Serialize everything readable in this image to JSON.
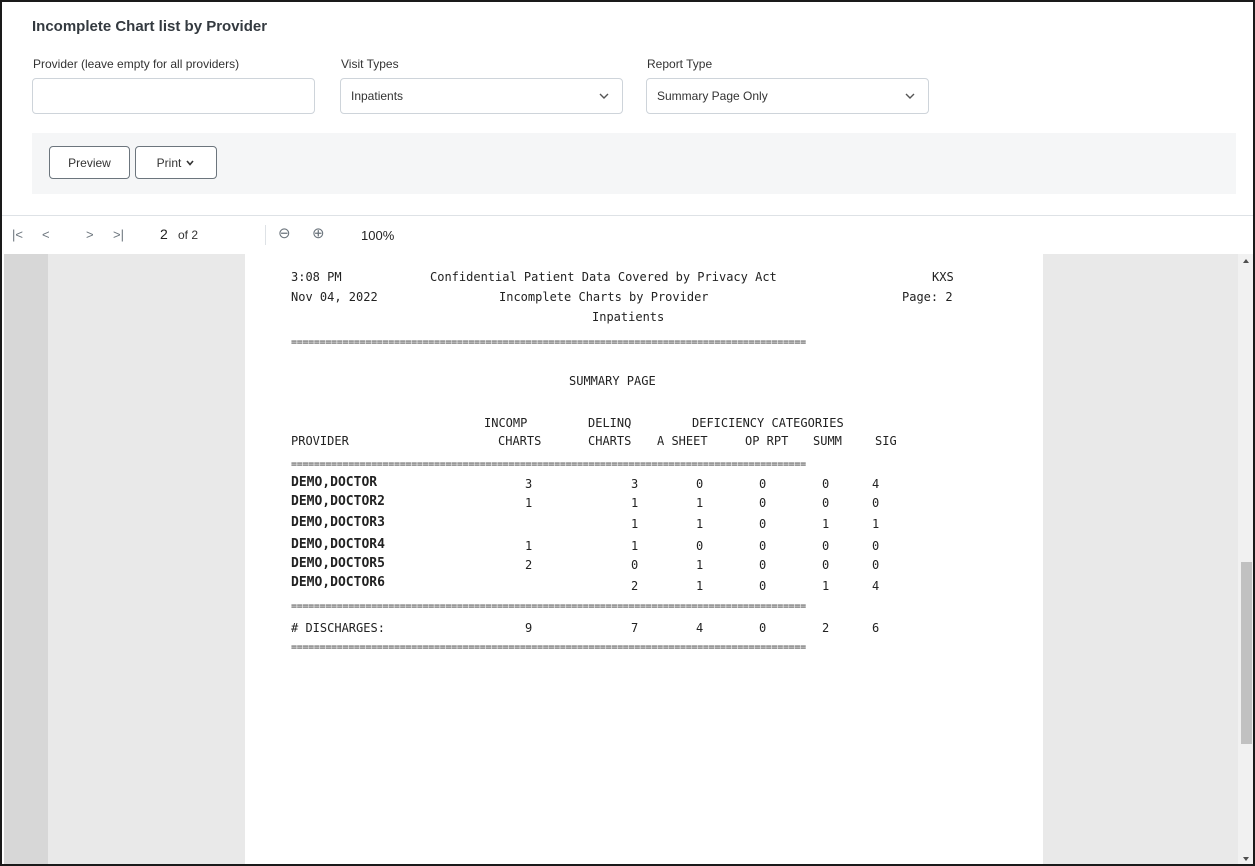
{
  "page": {
    "title": "Incomplete Chart list by Provider"
  },
  "form": {
    "provider_label": "Provider (leave empty for all providers)",
    "provider_value": "",
    "visit_types_label": "Visit Types",
    "visit_types_value": "Inpatients",
    "report_type_label": "Report Type",
    "report_type_value": "Summary Page Only"
  },
  "actions": {
    "preview_label": "Preview",
    "print_label": "Print"
  },
  "toolbar": {
    "first_icon": "|<",
    "prev_icon": "<",
    "next_icon": ">",
    "last_icon": ">|",
    "current_page": "2",
    "of_pages": "of 2",
    "zoom_out_icon": "⊖",
    "zoom_in_icon": "⊕",
    "zoom": "100%"
  },
  "report": {
    "time": "3:08 PM",
    "date": "Nov 04, 2022",
    "confidential": "Confidential Patient Data Covered by Privacy Act",
    "report_title": "Incomplete Charts by Provider",
    "visit_type": "Inpatients",
    "user": "KXS",
    "page": "Page: 2",
    "rule": "==========================================================================================",
    "section": "SUMMARY PAGE",
    "headers": {
      "incomp_top": "INCOMP",
      "delinq_top": "DELINQ",
      "deficiency_top": "DEFICIENCY CATEGORIES",
      "provider": "PROVIDER",
      "incomp": "CHARTS",
      "delinq": "CHARTS",
      "a_sheet": "A SHEET",
      "op_rpt": "OP RPT",
      "summ": "SUMM",
      "sig": "SIG"
    },
    "rows": [
      {
        "provider": "DEMO,DOCTOR",
        "incomp": "3",
        "delinq": "3",
        "a_sheet": "0",
        "op_rpt": "0",
        "summ": "0",
        "sig": "4"
      },
      {
        "provider": "DEMO,DOCTOR2",
        "incomp": "1",
        "delinq": "1",
        "a_sheet": "1",
        "op_rpt": "0",
        "summ": "0",
        "sig": "0"
      },
      {
        "provider": "DEMO,DOCTOR3",
        "incomp": "",
        "delinq": "1",
        "a_sheet": "1",
        "op_rpt": "0",
        "summ": "1",
        "sig": "1"
      },
      {
        "provider": "DEMO,DOCTOR4",
        "incomp": "1",
        "delinq": "1",
        "a_sheet": "0",
        "op_rpt": "0",
        "summ": "0",
        "sig": "0"
      },
      {
        "provider": "DEMO,DOCTOR5",
        "incomp": "2",
        "delinq": "0",
        "a_sheet": "1",
        "op_rpt": "0",
        "summ": "0",
        "sig": "0"
      },
      {
        "provider": "DEMO,DOCTOR6",
        "incomp": "",
        "delinq": "2",
        "a_sheet": "1",
        "op_rpt": "0",
        "summ": "1",
        "sig": "4"
      }
    ],
    "totals": {
      "label": "# DISCHARGES:",
      "incomp": "9",
      "delinq": "7",
      "a_sheet": "4",
      "op_rpt": "0",
      "summ": "2",
      "sig": "6"
    }
  }
}
